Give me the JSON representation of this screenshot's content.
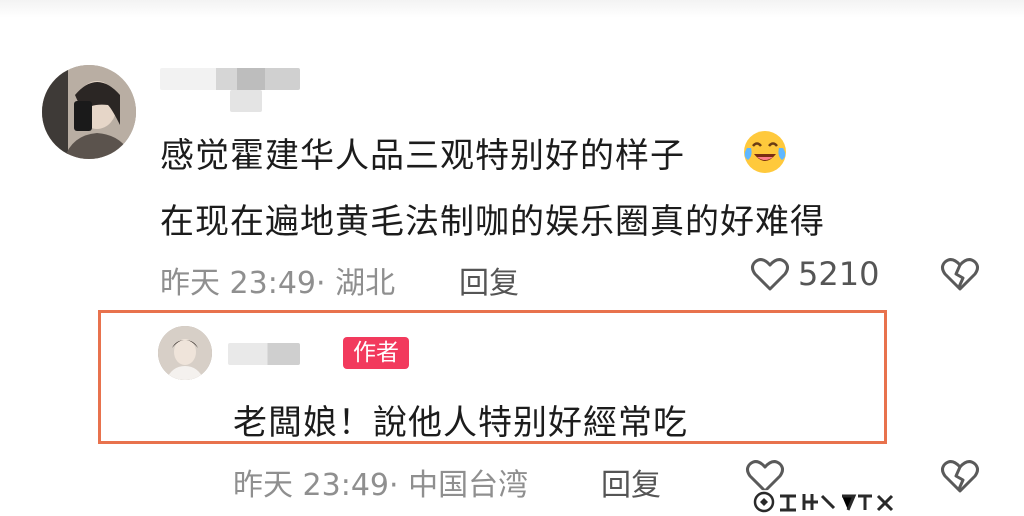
{
  "comment": {
    "lines": [
      "感觉霍建华人品三观特别好的样子",
      "在现在遍地黄毛法制咖的娱乐圈真的好难得"
    ],
    "emoji_icon": "crying-laughing-face-icon",
    "meta": "昨天 23:49· 湖北",
    "reply_label": "回复",
    "like_count": "5210"
  },
  "reply": {
    "badge": "作者",
    "text": "老闆娘！說他人特别好經常吃",
    "meta": "昨天 23:49· 中国台湾",
    "reply_label": "回复"
  },
  "colors": {
    "highlight_border": "#e8724d",
    "author_badge": "#f23a5d",
    "meta_text": "#8f8f8f",
    "body_text": "#1c1c1c"
  }
}
